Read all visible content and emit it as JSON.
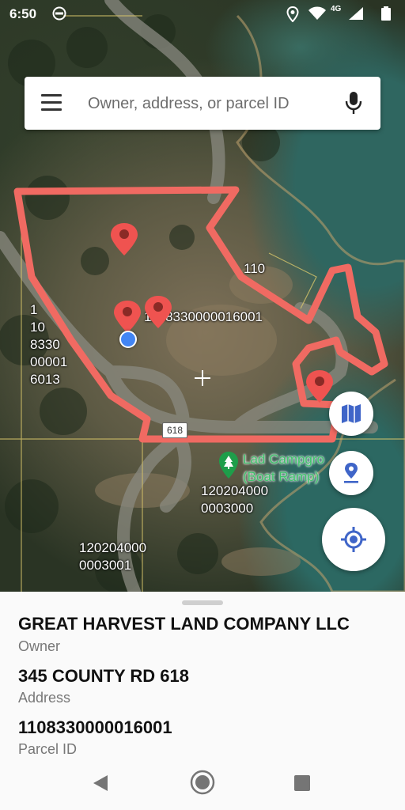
{
  "status_bar": {
    "time": "6:50",
    "network": "4G"
  },
  "search": {
    "placeholder": "Owner, address, or parcel ID"
  },
  "map": {
    "parcel_label_center": "1108330000016001",
    "parcel_label_left": "1\n10\n8330\n00001\n6013",
    "parcel_label_110": "110",
    "road_shield": "618",
    "poi_name": "Lad Campgro\n(Boat Ramp)",
    "parcel_label_poi": "120204000\n0003000",
    "parcel_label_bottom": "120204000\n0003001",
    "colors": {
      "parcel_outline": "#f06a62",
      "pin": "#ef5350",
      "location_dot": "#4285f4",
      "poi": "#1e9e4a"
    }
  },
  "fabs": {
    "layers_icon": "map-icon",
    "pin_icon": "place-icon",
    "locate_icon": "my-location-icon",
    "accent": "#3f65c8"
  },
  "details": {
    "owner_value": "GREAT HARVEST LAND COMPANY LLC",
    "owner_label": "Owner",
    "address_value": "345 COUNTY RD 618",
    "address_label": "Address",
    "parcel_value": "1108330000016001",
    "parcel_label": "Parcel ID"
  }
}
